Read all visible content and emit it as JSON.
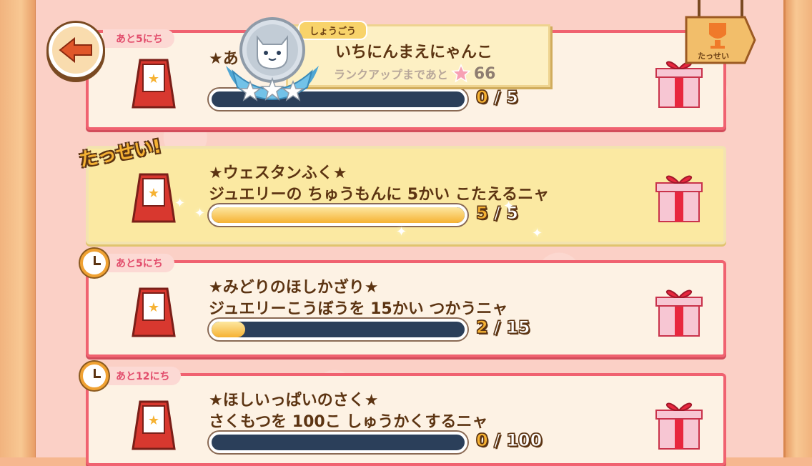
{
  "header": {
    "back_label": "",
    "title_tag": "しょうごう",
    "title_name": "いちにんまえにゃんこ",
    "rank_note": "ランクアップまであと",
    "rank_count": "66",
    "trophy_label": "たっせい"
  },
  "missions": [
    {
      "days_left": "あと5にち",
      "title": "★あ",
      "description": "",
      "current": "0",
      "separator": "/",
      "goal": "5",
      "progress": 0.0,
      "achieved": false
    },
    {
      "days_left": "",
      "achieved_label": "たっせい!",
      "title": "★ウェスタンふく★",
      "description": "ジュエリーの ちゅうもんに 5かい こたえるニャ",
      "current": "5",
      "separator": "/",
      "goal": "5",
      "progress": 1.0,
      "achieved": true
    },
    {
      "days_left": "あと5にち",
      "title": "★みどりのほしかざり★",
      "description": "ジュエリーこうぼうを 15かい つかうニャ",
      "current": "2",
      "separator": "/",
      "goal": "15",
      "progress": 0.133,
      "achieved": false
    },
    {
      "days_left": "あと12にち",
      "title": "★ほしいっぱいのさく★",
      "description": "さくもつを 100こ しゅうかくするニャ",
      "current": "0",
      "separator": "/",
      "goal": "100",
      "progress": 0.0,
      "achieved": false
    }
  ],
  "colors": {
    "card_border": "#f06270",
    "card_bg": "#fdf2e4",
    "done_bg": "#fbe9a2",
    "bar_bg": "#2b3f5a",
    "bar_fill": "#f6b233",
    "text": "#5c3412"
  },
  "icons": {
    "back": "arrow-left-icon",
    "medal": "cat-medal-icon",
    "trophy": "trophy-icon",
    "easel": "easel-icon",
    "gift": "gift-box-icon",
    "clock": "clock-icon",
    "star": "star-icon"
  }
}
